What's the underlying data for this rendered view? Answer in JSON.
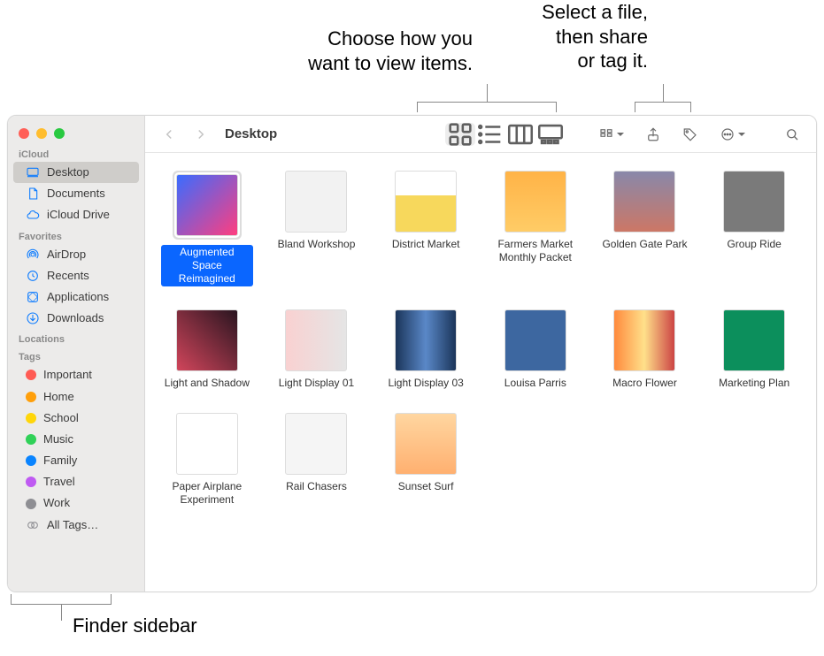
{
  "callouts": {
    "view": "Choose how you\nwant to view items.",
    "share": "Select a file,\nthen share\nor tag it.",
    "sidebar": "Finder sidebar"
  },
  "window": {
    "title": "Desktop"
  },
  "sidebar": {
    "sections": {
      "icloud": {
        "header": "iCloud",
        "items": [
          {
            "label": "Desktop",
            "icon": "desktop",
            "selected": true
          },
          {
            "label": "Documents",
            "icon": "doc"
          },
          {
            "label": "iCloud Drive",
            "icon": "cloud"
          }
        ]
      },
      "favorites": {
        "header": "Favorites",
        "items": [
          {
            "label": "AirDrop",
            "icon": "airdrop"
          },
          {
            "label": "Recents",
            "icon": "clock"
          },
          {
            "label": "Applications",
            "icon": "apps"
          },
          {
            "label": "Downloads",
            "icon": "download"
          }
        ]
      },
      "locations": {
        "header": "Locations"
      },
      "tags": {
        "header": "Tags",
        "items": [
          {
            "label": "Important",
            "color": "#ff5b54"
          },
          {
            "label": "Home",
            "color": "#ff9f0a"
          },
          {
            "label": "School",
            "color": "#ffd60a"
          },
          {
            "label": "Music",
            "color": "#30d158"
          },
          {
            "label": "Family",
            "color": "#0a84ff"
          },
          {
            "label": "Travel",
            "color": "#bf5af2"
          },
          {
            "label": "Work",
            "color": "#8e8e93"
          },
          {
            "label": "All Tags…",
            "color": "",
            "all": true
          }
        ]
      }
    }
  },
  "toolbar": {
    "views": [
      "icon",
      "list",
      "column",
      "gallery"
    ],
    "active_view": "icon"
  },
  "files": [
    {
      "label": "Augmented Space Reimagined",
      "thumb": "th-aug",
      "selected": true
    },
    {
      "label": "Bland Workshop",
      "thumb": "th-bland"
    },
    {
      "label": "District Market",
      "thumb": "th-dist"
    },
    {
      "label": "Farmers Market Monthly Packet",
      "thumb": "th-farm"
    },
    {
      "label": "Golden Gate Park",
      "thumb": "th-gg"
    },
    {
      "label": "Group Ride",
      "thumb": "th-group"
    },
    {
      "label": "Light and Shadow",
      "thumb": "th-ls"
    },
    {
      "label": "Light Display 01",
      "thumb": "th-ld1"
    },
    {
      "label": "Light Display 03",
      "thumb": "th-ld3"
    },
    {
      "label": "Louisa Parris",
      "thumb": "th-lp"
    },
    {
      "label": "Macro Flower",
      "thumb": "th-mf"
    },
    {
      "label": "Marketing Plan",
      "thumb": "th-mp"
    },
    {
      "label": "Paper Airplane Experiment",
      "thumb": "th-pa"
    },
    {
      "label": "Rail Chasers",
      "thumb": "th-rc"
    },
    {
      "label": "Sunset Surf",
      "thumb": "th-ss"
    }
  ]
}
